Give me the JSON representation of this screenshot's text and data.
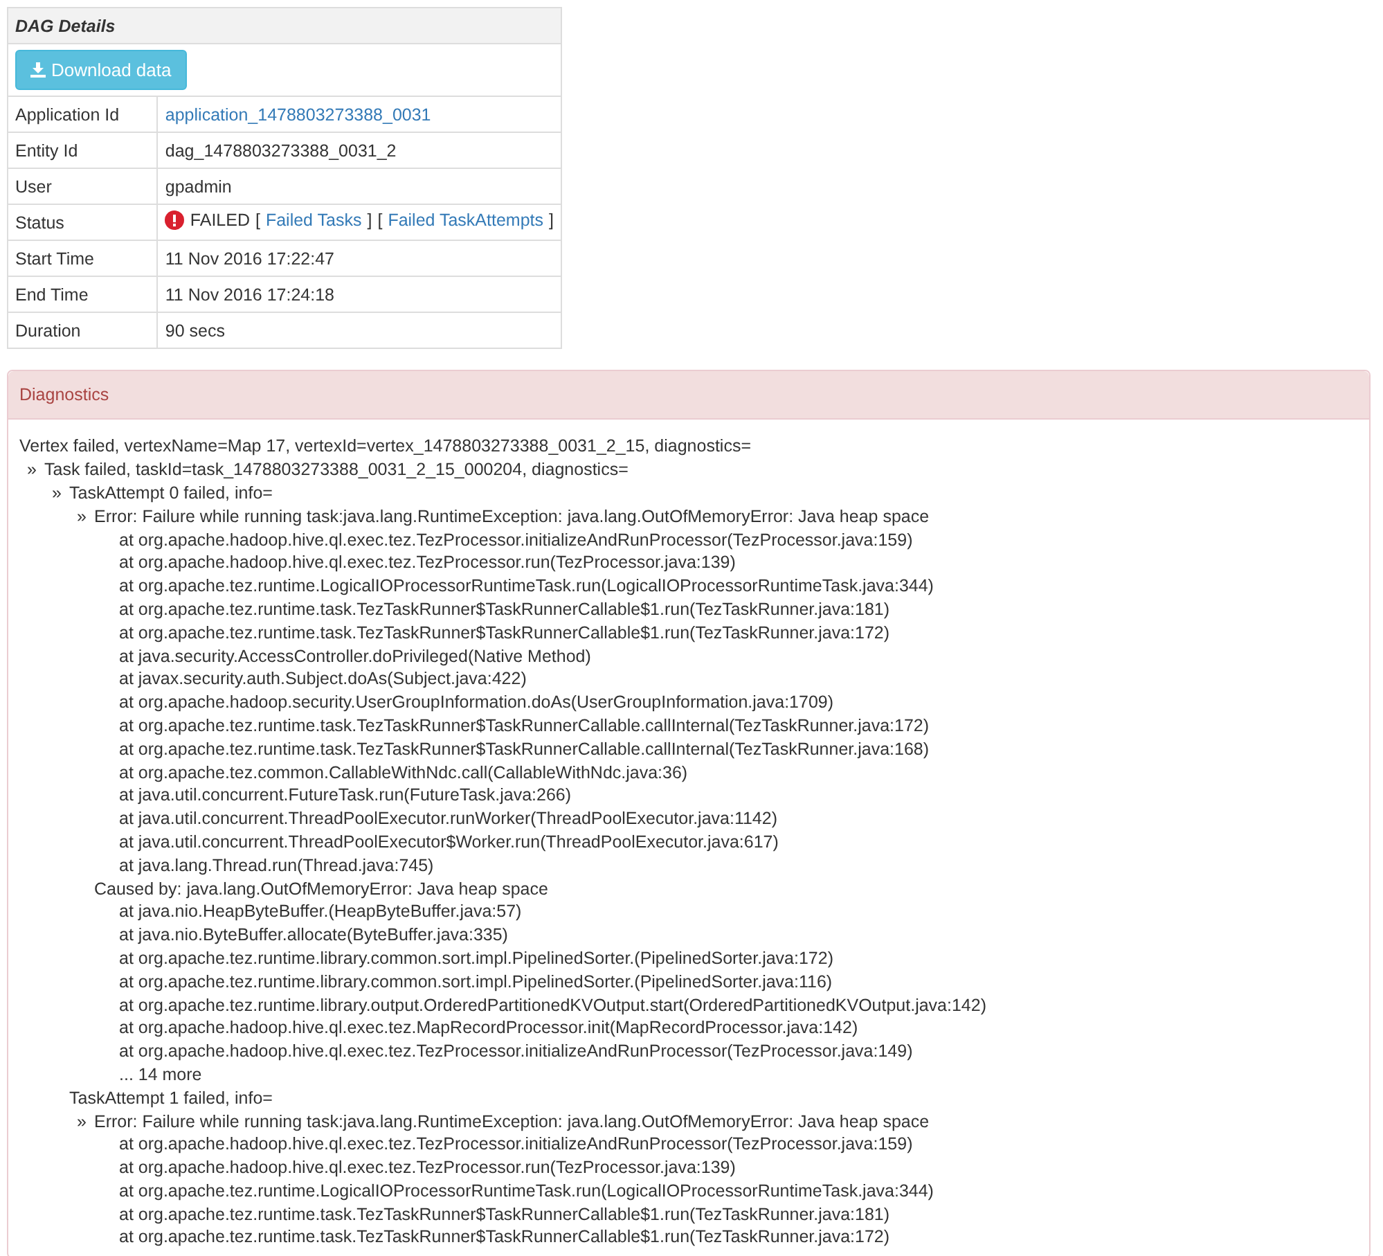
{
  "details": {
    "title": "DAG Details",
    "download_button": "Download data",
    "rows": [
      {
        "label": "Application Id",
        "value": "application_1478803273388_0031",
        "kind": "link"
      },
      {
        "label": "Entity Id",
        "value": "dag_1478803273388_0031_2",
        "kind": "text"
      },
      {
        "label": "User",
        "value": "gpadmin",
        "kind": "text"
      },
      {
        "label": "Status",
        "kind": "status",
        "status": "FAILED",
        "links": [
          {
            "open": "[",
            "label": "Failed Tasks",
            "close": "]"
          },
          {
            "open": "[",
            "label": "Failed TaskAttempts",
            "close": "]"
          }
        ]
      },
      {
        "label": "Start Time",
        "value": "11 Nov 2016 17:22:47",
        "kind": "text"
      },
      {
        "label": "End Time",
        "value": "11 Nov 2016 17:24:18",
        "kind": "text"
      },
      {
        "label": "Duration",
        "value": "90 secs",
        "kind": "text"
      }
    ]
  },
  "diagnostics": {
    "title": "Diagnostics",
    "lines": [
      {
        "text": "Vertex failed, vertexName=Map 17, vertexId=vertex_1478803273388_0031_2_15, diagnostics=",
        "children": [
          {
            "marker": "»",
            "text": "Task failed, taskId=task_1478803273388_0031_2_15_000204, diagnostics=",
            "children": [
              {
                "marker": "»",
                "text": "TaskAttempt 0 failed, info=",
                "children": [
                  {
                    "marker": "»",
                    "text": "Error: Failure while running task:java.lang.RuntimeException: java.lang.OutOfMemoryError: Java heap space",
                    "children": [
                      {
                        "text": "at org.apache.hadoop.hive.ql.exec.tez.TezProcessor.initializeAndRunProcessor(TezProcessor.java:159)"
                      },
                      {
                        "text": "at org.apache.hadoop.hive.ql.exec.tez.TezProcessor.run(TezProcessor.java:139)"
                      },
                      {
                        "text": "at org.apache.tez.runtime.LogicalIOProcessorRuntimeTask.run(LogicalIOProcessorRuntimeTask.java:344)"
                      },
                      {
                        "text": "at org.apache.tez.runtime.task.TezTaskRunner$TaskRunnerCallable$1.run(TezTaskRunner.java:181)"
                      },
                      {
                        "text": "at org.apache.tez.runtime.task.TezTaskRunner$TaskRunnerCallable$1.run(TezTaskRunner.java:172)"
                      },
                      {
                        "text": "at java.security.AccessController.doPrivileged(Native Method)"
                      },
                      {
                        "text": "at javax.security.auth.Subject.doAs(Subject.java:422)"
                      },
                      {
                        "text": "at org.apache.hadoop.security.UserGroupInformation.doAs(UserGroupInformation.java:1709)"
                      },
                      {
                        "text": "at org.apache.tez.runtime.task.TezTaskRunner$TaskRunnerCallable.callInternal(TezTaskRunner.java:172)"
                      },
                      {
                        "text": "at org.apache.tez.runtime.task.TezTaskRunner$TaskRunnerCallable.callInternal(TezTaskRunner.java:168)"
                      },
                      {
                        "text": "at org.apache.tez.common.CallableWithNdc.call(CallableWithNdc.java:36)"
                      },
                      {
                        "text": "at java.util.concurrent.FutureTask.run(FutureTask.java:266)"
                      },
                      {
                        "text": "at java.util.concurrent.ThreadPoolExecutor.runWorker(ThreadPoolExecutor.java:1142)"
                      },
                      {
                        "text": "at java.util.concurrent.ThreadPoolExecutor$Worker.run(ThreadPoolExecutor.java:617)"
                      },
                      {
                        "text": "at java.lang.Thread.run(Thread.java:745)"
                      }
                    ]
                  },
                  {
                    "text": "Caused by: java.lang.OutOfMemoryError: Java heap space",
                    "children": [
                      {
                        "text": "at java.nio.HeapByteBuffer.(HeapByteBuffer.java:57)"
                      },
                      {
                        "text": "at java.nio.ByteBuffer.allocate(ByteBuffer.java:335)"
                      },
                      {
                        "text": "at org.apache.tez.runtime.library.common.sort.impl.PipelinedSorter.(PipelinedSorter.java:172)"
                      },
                      {
                        "text": "at org.apache.tez.runtime.library.common.sort.impl.PipelinedSorter.(PipelinedSorter.java:116)"
                      },
                      {
                        "text": "at org.apache.tez.runtime.library.output.OrderedPartitionedKVOutput.start(OrderedPartitionedKVOutput.java:142)"
                      },
                      {
                        "text": "at org.apache.hadoop.hive.ql.exec.tez.MapRecordProcessor.init(MapRecordProcessor.java:142)"
                      },
                      {
                        "text": "at org.apache.hadoop.hive.ql.exec.tez.TezProcessor.initializeAndRunProcessor(TezProcessor.java:149)"
                      },
                      {
                        "text": "... 14 more"
                      }
                    ]
                  }
                ]
              },
              {
                "text": "TaskAttempt 1 failed, info=",
                "children": [
                  {
                    "marker": "»",
                    "text": "Error: Failure while running task:java.lang.RuntimeException: java.lang.OutOfMemoryError: Java heap space",
                    "children": [
                      {
                        "text": "at org.apache.hadoop.hive.ql.exec.tez.TezProcessor.initializeAndRunProcessor(TezProcessor.java:159)"
                      },
                      {
                        "text": "at org.apache.hadoop.hive.ql.exec.tez.TezProcessor.run(TezProcessor.java:139)"
                      },
                      {
                        "text": "at org.apache.tez.runtime.LogicalIOProcessorRuntimeTask.run(LogicalIOProcessorRuntimeTask.java:344)"
                      },
                      {
                        "text": "at org.apache.tez.runtime.task.TezTaskRunner$TaskRunnerCallable$1.run(TezTaskRunner.java:181)"
                      },
                      {
                        "text": "at org.apache.tez.runtime.task.TezTaskRunner$TaskRunnerCallable$1.run(TezTaskRunner.java:172)"
                      }
                    ]
                  }
                ]
              }
            ]
          }
        ]
      }
    ]
  }
}
